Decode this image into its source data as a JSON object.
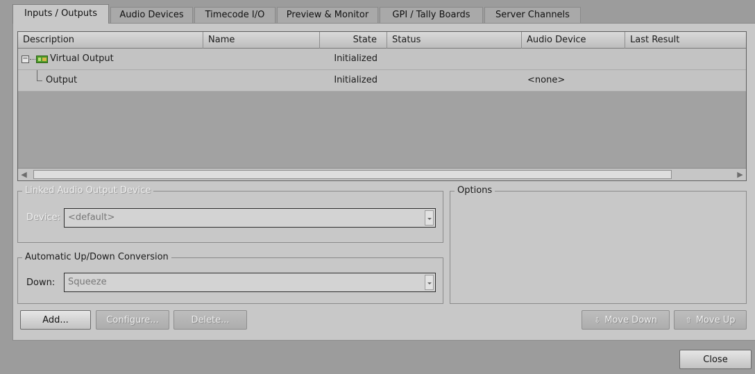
{
  "tabs": [
    {
      "label": "Inputs / Outputs",
      "active": true
    },
    {
      "label": "Audio Devices"
    },
    {
      "label": "Timecode I/O"
    },
    {
      "label": "Preview & Monitor"
    },
    {
      "label": "GPI / Tally Boards"
    },
    {
      "label": "Server Channels"
    }
  ],
  "grid": {
    "columns": [
      "Description",
      "Name",
      "State",
      "Status",
      "Audio Device",
      "Last Result"
    ],
    "rows": [
      {
        "description": "Virtual Output",
        "name": "",
        "state": "Initialized",
        "status": "",
        "audio_device": "",
        "last_result": "",
        "expander": "−",
        "icon": "video-card-icon"
      },
      {
        "description": "Output",
        "name": "",
        "state": "Initialized",
        "status": "",
        "audio_device": "<none>",
        "last_result": ""
      }
    ]
  },
  "linked_audio": {
    "title": "Linked Audio Output Device",
    "device_label": "Device:",
    "device_value": "<default>"
  },
  "conversion": {
    "title": "Automatic Up/Down Conversion",
    "down_label": "Down:",
    "down_value": "Squeeze"
  },
  "options": {
    "title": "Options"
  },
  "buttons": {
    "add": "Add...",
    "configure": "Configure...",
    "delete": "Delete...",
    "move_down": "Move Down",
    "move_up": "Move Up",
    "close": "Close"
  },
  "scrollbar": {
    "left_arrow": "◀",
    "right_arrow": "▶"
  },
  "colors": {
    "window_bg": "#9c9c9c",
    "panel_bg": "#c8c8c8",
    "row_bg": "#c3c3c3",
    "icon_green": "#4c9a2a"
  }
}
